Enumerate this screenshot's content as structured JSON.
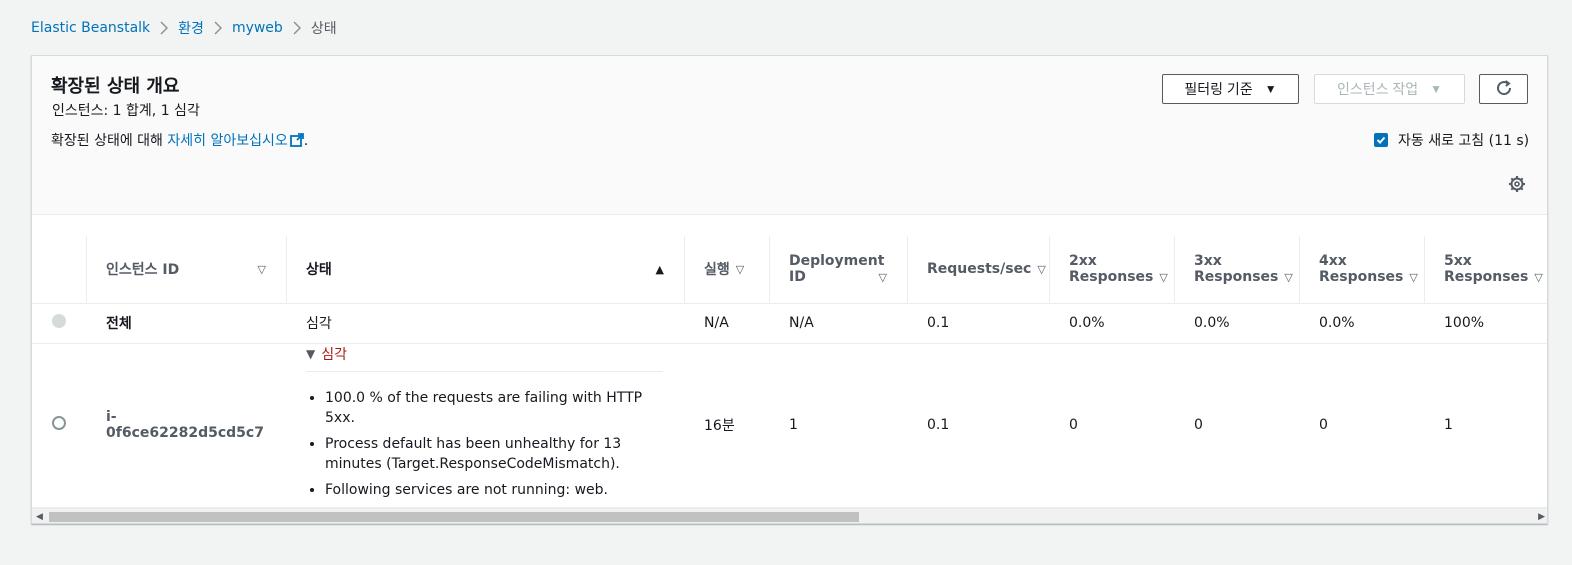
{
  "breadcrumb": {
    "items": [
      "Elastic Beanstalk",
      "환경",
      "myweb"
    ],
    "current": "상태"
  },
  "panel": {
    "title": "확장된 상태 개요",
    "subtitle": "인스턴스: 1 합계, 1 심각",
    "desc_prefix": "확장된 상태에 대해 ",
    "desc_link": "자세히 알아보십시오",
    "desc_suffix": ".",
    "filter_button": "필터링 기준",
    "actions_button": "인스턴스 작업",
    "auto_refresh_label": "자동 새로 고침 (11 s)",
    "auto_refresh_checked": true
  },
  "table": {
    "headers": {
      "instance_id": "인스턴스 ID",
      "status": "상태",
      "running": "실행",
      "deployment_id_1": "Deployment",
      "deployment_id_2": "ID",
      "requests": "Requests/sec",
      "r2xx_1": "2xx",
      "r2xx_2": "Responses",
      "r3xx_1": "3xx",
      "r3xx_2": "Responses",
      "r4xx_1": "4xx",
      "r4xx_2": "Responses",
      "r5xx_1": "5xx",
      "r5xx_2": "Responses"
    },
    "overall": {
      "name": "전체",
      "status": "심각",
      "running": "N/A",
      "deployment_id": "N/A",
      "requests": "0.1",
      "r2xx": "0.0%",
      "r3xx": "0.0%",
      "r4xx": "0.0%",
      "r5xx": "100%"
    },
    "instance": {
      "id": "i-0f6ce62282d5cd5c7",
      "status": "심각",
      "causes": [
        "100.0 % of the requests are failing with HTTP 5xx.",
        "Process default has been unhealthy for 13 minutes (Target.ResponseCodeMismatch).",
        "Following services are not running: web."
      ],
      "running": "16분",
      "deployment_id": "1",
      "requests": "0.1",
      "r2xx": "0",
      "r3xx": "0",
      "r4xx": "0",
      "r5xx": "1"
    }
  },
  "colors": {
    "link": "#0073bb",
    "severe": "#b0150f",
    "background": "#f2f3f3"
  }
}
